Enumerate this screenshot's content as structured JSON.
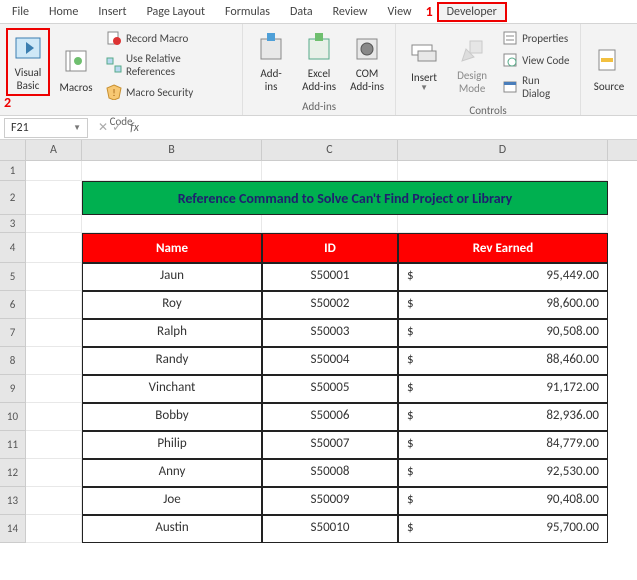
{
  "tabs": {
    "file": "File",
    "home": "Home",
    "insert": "Insert",
    "page_layout": "Page Layout",
    "formulas": "Formulas",
    "data": "Data",
    "review": "Review",
    "view": "View",
    "developer": "Developer"
  },
  "callouts": {
    "one": "1",
    "two": "2"
  },
  "ribbon": {
    "code": {
      "visual_basic": "Visual\nBasic",
      "macros": "Macros",
      "record_macro": "Record Macro",
      "use_relative": "Use Relative References",
      "macro_security": "Macro Security",
      "group_label": "Code"
    },
    "addins": {
      "addins": "Add-\nins",
      "excel_addins": "Excel\nAdd-ins",
      "com_addins": "COM\nAdd-ins",
      "group_label": "Add-ins"
    },
    "controls": {
      "insert": "Insert",
      "design_mode": "Design\nMode",
      "properties": "Properties",
      "view_code": "View Code",
      "run_dialog": "Run Dialog",
      "group_label": "Controls"
    },
    "source": {
      "source": "Source"
    }
  },
  "name_box": "F21",
  "fx_label": "fx",
  "columns": [
    "A",
    "B",
    "C",
    "D"
  ],
  "title": "Reference Command to Solve Can't Find Project or Library",
  "headers": {
    "name": "Name",
    "id": "ID",
    "rev": "Rev Earned"
  },
  "rows": [
    {
      "n": "Jaun",
      "id": "S50001",
      "rev": "95,449.00"
    },
    {
      "n": "Roy",
      "id": "S50002",
      "rev": "98,600.00"
    },
    {
      "n": "Ralph",
      "id": "S50003",
      "rev": "90,508.00"
    },
    {
      "n": "Randy",
      "id": "S50004",
      "rev": "88,460.00"
    },
    {
      "n": "Vinchant",
      "id": "S50005",
      "rev": "91,172.00"
    },
    {
      "n": "Bobby",
      "id": "S50006",
      "rev": "82,936.00"
    },
    {
      "n": "Philip",
      "id": "S50007",
      "rev": "84,779.00"
    },
    {
      "n": "Anny",
      "id": "S50008",
      "rev": "92,530.00"
    },
    {
      "n": "Joe",
      "id": "S50009",
      "rev": "90,408.00"
    },
    {
      "n": "Austin",
      "id": "S50010",
      "rev": "95,700.00"
    }
  ],
  "currency_symbol": "$",
  "row_numbers": [
    "1",
    "2",
    "3",
    "4",
    "5",
    "6",
    "7",
    "8",
    "9",
    "10",
    "11",
    "12",
    "13",
    "14"
  ]
}
